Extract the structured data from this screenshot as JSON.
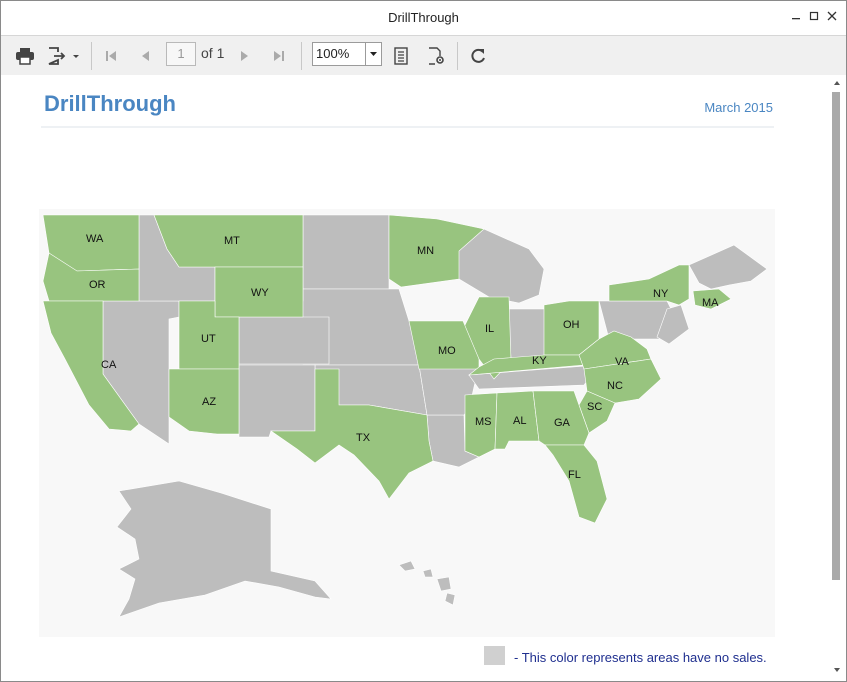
{
  "window": {
    "title": "DrillThrough"
  },
  "toolbar": {
    "page_current": "1",
    "page_of": "of 1",
    "zoom": "100%"
  },
  "report": {
    "title": "DrillThrough",
    "date": "March 2015",
    "legend_text": "- This color represents areas have no sales."
  },
  "map": {
    "sales_color": "#98c47f",
    "no_sales_color": "#bdbdbd",
    "state_labels": [
      "WA",
      "MT",
      "MN",
      "OR",
      "WY",
      "NY",
      "MA",
      "UT",
      "OH",
      "IL",
      "MO",
      "KY",
      "VA",
      "CA",
      "NC",
      "SC",
      "AZ",
      "MS",
      "AL",
      "GA",
      "TX",
      "FL"
    ]
  },
  "colors": {
    "title": "#4a86c2",
    "legend_text": "#1f2f8f"
  }
}
